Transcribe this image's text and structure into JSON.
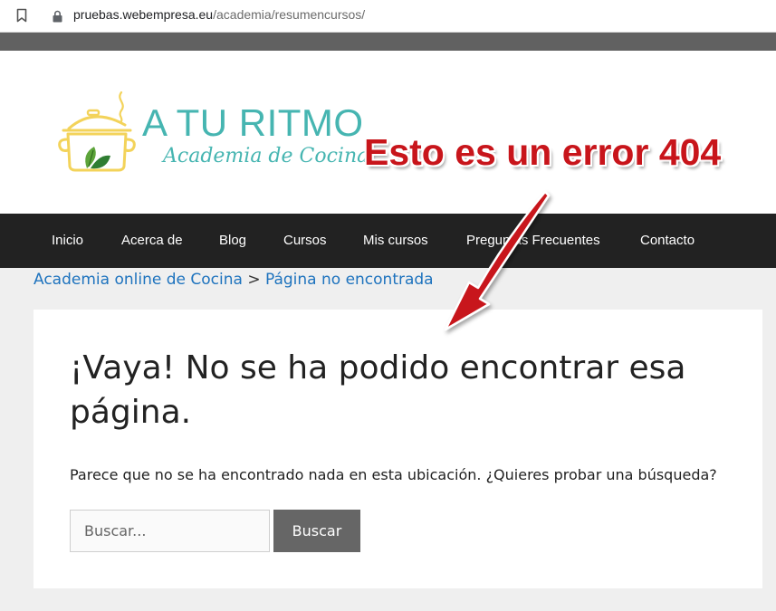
{
  "browser": {
    "url_host": "pruebas.webempresa.eu",
    "url_path": "/academia/resumencursos/",
    "bookmark_icon": "bookmark-icon",
    "lock_icon": "lock-icon"
  },
  "header": {
    "logo_title": "A TU RITMO",
    "logo_subtitle": "Academia de Cocina",
    "logo_icon": "cooking-pot-icon",
    "annotation": "Esto es un error 404",
    "annotation_color": "#c8151b",
    "brand_color": "#46b5b1"
  },
  "nav": {
    "items": [
      {
        "label": "Inicio"
      },
      {
        "label": "Acerca de"
      },
      {
        "label": "Blog"
      },
      {
        "label": "Cursos"
      },
      {
        "label": "Mis cursos"
      },
      {
        "label": "Preguntas Frecuentes"
      },
      {
        "label": "Contacto"
      }
    ]
  },
  "breadcrumb": {
    "home": "Academia online de Cocina",
    "separator": ">",
    "current": "Página no encontrada"
  },
  "content": {
    "title": "¡Vaya! No se ha podido encontrar esa página.",
    "message": "Parece que no se ha encontrado nada en esta ubicación. ¿Quieres probar una búsqueda?",
    "search_placeholder": "Buscar...",
    "search_button": "Buscar"
  }
}
